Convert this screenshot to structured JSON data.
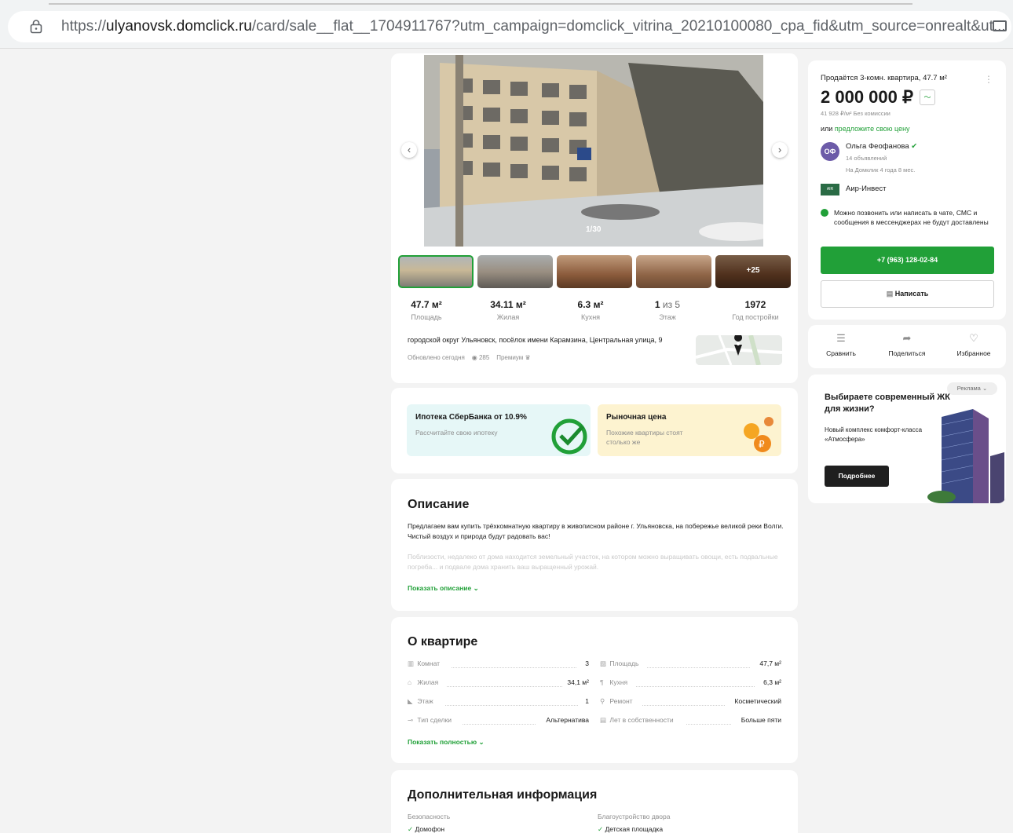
{
  "browser": {
    "url_prefix": "https://",
    "url_domain": "ulyanovsk.domclick.ru",
    "url_rest": "/card/sale__flat__1704911767?utm_campaign=domclick_vitrina_20210100080_cpa_fid&utm_source=onrealt&ut..."
  },
  "gallery": {
    "counter": "1/30",
    "more_label": "+25",
    "stats": [
      {
        "value": "47.7 м²",
        "extra": "",
        "label": "Площадь"
      },
      {
        "value": "34.11 м²",
        "extra": "",
        "label": "Жилая"
      },
      {
        "value": "6.3 м²",
        "extra": "",
        "label": "Кухня"
      },
      {
        "value": "1",
        "extra": " из 5",
        "label": "Этаж"
      },
      {
        "value": "1972",
        "extra": "",
        "label": "Год постройки"
      }
    ],
    "address": "городской округ Ульяновск, посёлок имени Карамзина, Центральная улица, 9",
    "updated": "Обновлено сегодня",
    "views": "285",
    "premium": "Премиум"
  },
  "promo": {
    "mortgage_title": "Ипотека СберБанка от 10.9%",
    "mortgage_sub": "Рассчитайте свою ипотеку",
    "market_title": "Рыночная цена",
    "market_sub": "Похожие квартиры стоят столько же"
  },
  "description": {
    "title": "Описание",
    "text": "Предлагаем вам купить трёхкомнатную квартиру в живописном районе г. Ульяновска, на побережье великой реки Волги. Чистый воздух и природа будут радовать вас!",
    "faded": "Поблизости, недалеко от дома находится земельный участок, на котором можно выращивать овощи, есть подвальные погреба... и подвале дома хранить ваш выращенный урожай.",
    "show_more": "Показать описание"
  },
  "about": {
    "title": "О квартире",
    "rows": [
      {
        "icon": "rooms-icon",
        "label": "Комнат",
        "value": "3"
      },
      {
        "icon": "area-icon",
        "label": "Площадь",
        "value": "47,7 м²"
      },
      {
        "icon": "living-icon",
        "label": "Жилая",
        "value": "34,1 м²"
      },
      {
        "icon": "kitchen-icon",
        "label": "Кухня",
        "value": "6,3 м²"
      },
      {
        "icon": "floor-icon",
        "label": "Этаж",
        "value": "1"
      },
      {
        "icon": "repair-icon",
        "label": "Ремонт",
        "value": "Косметический"
      },
      {
        "icon": "deal-icon",
        "label": "Тип сделки",
        "value": "Альтернатива"
      },
      {
        "icon": "ownership-icon",
        "label": "Лет в собственности",
        "value": "Больше пяти"
      }
    ],
    "show_more": "Показать полностью"
  },
  "extra": {
    "title": "Дополнительная информация",
    "col1_title": "Безопасность",
    "col1_item": "Домофон",
    "col2_title": "Благоустройство двора",
    "col2_item": "Детская площадка"
  },
  "seller": {
    "title": "Продаётся 3-комн. квартира, 47.7 м²",
    "price": "2 000 000 ₽",
    "per_meter": "41 928 ₽/м²   Без комиссии",
    "offer_prefix": "или ",
    "offer_link": "предложите свою цену",
    "avatar": "ОФ",
    "agent_name": "Ольга Феофанова",
    "agent_listings": "14 объявлений",
    "agent_since": "На Домклик 4 года 8 мес.",
    "agency_name": "Аир-Инвест",
    "notice": "Можно позвонить или написать в чате, СМС и сообщения в мессенджерах не будут доставлены",
    "phone": "+7 (963) 128-02-84",
    "write": "Написать"
  },
  "actions": {
    "compare": "Сравнить",
    "share": "Поделиться",
    "favorite": "Избранное"
  },
  "ad": {
    "tag": "Реклама",
    "title": "Выбираете современный ЖК для жизни?",
    "text": "Новый комплекс комфорт-класса «Атмосфера»",
    "button": "Подробнее"
  },
  "colors": {
    "accent": "#21a038",
    "market_bg": "#fdf3d0",
    "mortgage_bg": "#e6f7f7"
  }
}
